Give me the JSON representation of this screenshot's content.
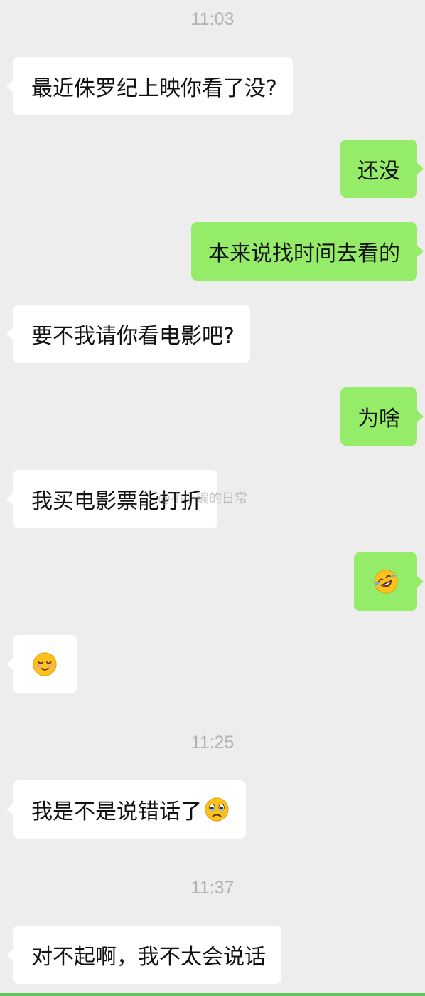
{
  "chat": {
    "timestamps": [
      "11:03",
      "11:25",
      "11:37"
    ],
    "messages": [
      {
        "side": "left",
        "text": "最近侏罗纪上映你看了没?"
      },
      {
        "side": "right",
        "text": "还没"
      },
      {
        "side": "right",
        "text": "本来说找时间去看的"
      },
      {
        "side": "left",
        "text": "要不我请你看电影吧?"
      },
      {
        "side": "right",
        "text": "为啥"
      },
      {
        "side": "left",
        "text": "我买电影票能打折"
      },
      {
        "side": "right",
        "emoji": "rolling-laughing-emoji"
      },
      {
        "side": "left",
        "emoji": "smiling-blush-emoji"
      },
      {
        "side": "left",
        "text": "我是不是说错话了",
        "emoji": "holding-back-tears-emoji"
      },
      {
        "side": "left",
        "text": "对不起啊，我不太会说话"
      }
    ]
  },
  "watermark": "@小小编的日常",
  "colors": {
    "background": "#ededed",
    "incoming_bubble": "#ffffff",
    "outgoing_bubble": "#95ec69",
    "timestamp": "#b2b2b2"
  }
}
